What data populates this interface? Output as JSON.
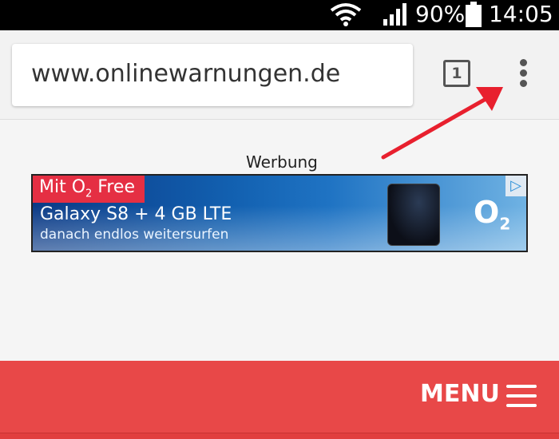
{
  "status_bar": {
    "battery": "90%",
    "time": "14:05"
  },
  "browser": {
    "url": "www.onlinewarnungen.de",
    "tab_count": "1"
  },
  "ad": {
    "label": "Werbung",
    "tag_prefix": "Mit O",
    "tag_sub": "2",
    "tag_suffix": " Free",
    "title": "Galaxy S8 + 4 GB LTE",
    "subtitle": "danach endlos weitersurfen",
    "brand": "O",
    "brand_sub": "2"
  },
  "site": {
    "menu_label": "MENU"
  },
  "colors": {
    "accent_red": "#e84848",
    "ad_tag_red": "#e52f43",
    "arrow_red": "#e8202e"
  },
  "icons": [
    "wifi-icon",
    "signal-icon",
    "battery-icon",
    "tabs-icon",
    "more-vert-icon",
    "hamburger-icon",
    "adchoices-icon"
  ]
}
